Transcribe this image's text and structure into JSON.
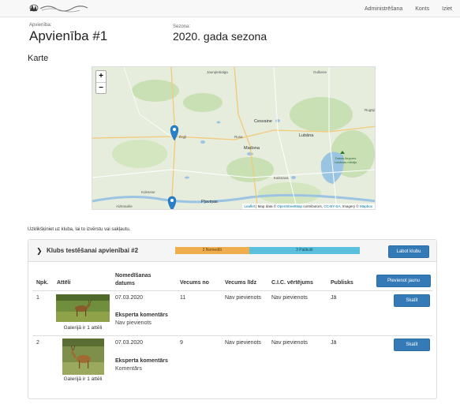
{
  "nav": {
    "logo_alt": "logo",
    "links": [
      "Administrēšana",
      "Konts",
      "Iziet"
    ]
  },
  "header": {
    "group_label": "Apvienība:",
    "group_value": "Apvienība #1",
    "season_label": "Sezona:",
    "season_value": "2020. gada sezona"
  },
  "map": {
    "title": "Karte",
    "zoom_in": "+",
    "zoom_out": "−",
    "places": [
      "Jaunpiebalga",
      "Gulbene",
      "Cesvaine",
      "Lubāna",
      "Madona",
      "Rugāji",
      "Ērgļi",
      "Rusa",
      "Kalsnava",
      "Pļaviņas",
      "Koknese",
      "Aizkraukle",
      "Dabas liegums Lubānas mitrājs"
    ],
    "attribution_leaflet": "Leaflet",
    "attribution_text": " | Map data © ",
    "attribution_osm": "OpenStreetMap",
    "attribution_mid": " contributors, ",
    "attribution_cc": "CC-BY-SA",
    "attribution_img": ", Imagery © ",
    "attribution_mapbox": "Mapbox"
  },
  "hint": "Uzklikšķiniet uz kluba, lai to izvērstu vai sakļautu.",
  "club": {
    "name": "Klubs testēšanai apvienībai #2",
    "progress_a": "2 Nomedīti",
    "progress_b": "3 Palikuši",
    "progress_a_fraction": 0.4,
    "edit_button": "Labot klubu",
    "add_button": "Pievienot jaunu",
    "columns": [
      "Npk.",
      "Attēli",
      "Nomedīšanas datums",
      "Vecums no",
      "Vecums līdz",
      "C.I.C. vērtējums",
      "Publisks"
    ],
    "expert_label": "Eksperta komentārs",
    "view_button": "Skatīt",
    "rows": [
      {
        "npk": "1",
        "date": "07.03.2020",
        "age_from": "11",
        "age_to": "Nav pievienots",
        "cic": "Nav pievienots",
        "public": "Jā",
        "gallery": "Galerijā ir 1 attēli",
        "expert_comment": "Nav pievienots"
      },
      {
        "npk": "2",
        "date": "07.03.2020",
        "age_from": "9",
        "age_to": "Nav pievienots",
        "cic": "Nav pievienots",
        "public": "Jā",
        "gallery": "Galerijā ir 1 attēli",
        "expert_comment": "Komentārs"
      }
    ]
  },
  "colors": {
    "primary": "#337ab7",
    "progress_warning": "#f0ad4e",
    "progress_info": "#5bc0de",
    "map_marker": "#2a81cb"
  }
}
